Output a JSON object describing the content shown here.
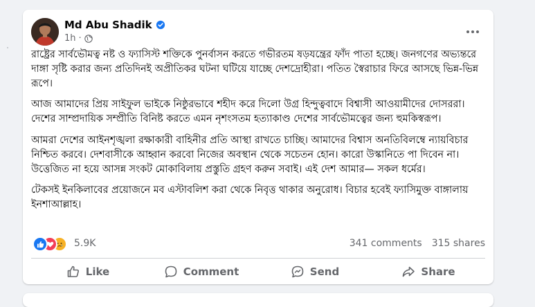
{
  "post": {
    "author": "Md Abu Shadik",
    "time": "1h",
    "dot": "·",
    "paragraphs": [
      "রাষ্ট্রের সার্বভৌমত্ব নষ্ট ও ফ্যাসিস্ট শক্তিকে পুনর্বাসন করতে গভীরতম ষড়যন্ত্রের ফাঁদ পাতা হচ্ছে। জনগণের অভ্যন্তরে দাঙ্গা সৃষ্টি করার জন্য প্রতিদিনই অপ্রীতিকর ঘটনা ঘটিয়ে যাচ্ছে দেশদ্রোহীরা। পতিত স্বৈরাচার ফিরে আসছে ভিন্ন-ভিন্ন রূপে।",
      "আজ আমাদের প্রিয় সাইফুল ভাইকে নিষ্ঠুরভাবে শহীদ করে দিলো উগ্র হিন্দুত্ববাদে বিশ্বাসী আওয়ামীদের দোসররা। দেশের সাম্প্রদায়িক সম্প্রীতি বিনিষ্ট করতে এমন নৃশংসতম হত্যাকাণ্ড দেশের সার্বভৌমত্বের জন্য হুমকিস্বরূপ।",
      "আমরা দেশের আইনশৃঙ্খলা রক্ষাকারী বাহিনীর প্রতি আস্থা রাখতে চাচ্ছি। আমাদের বিশ্বাস অনতিবিলম্বে ন্যায়বিচার নিশ্চিত করবে। দেশবাসীকে আহ্বান করবো নিজের অবস্থান থেকে সচেতন হোন। কারো উস্কানিতে পা দিবেন না। উত্তেজিত না হয়ে আসন্ন সংকট মোকাবিলায় প্রস্তুতি গ্রহণ করুন সবাই। এই দেশ আমার— সকল ধর্মের।",
      "টেকসই ইনকিলাবের প্রয়োজনে মব এস্টাবলিশ করা থেকে নিবৃত্ত থাকার অনুরোধ। বিচার হবেই ফ্যাসিমুক্ত বাঙ্গালায় ইনশাআল্লাহ।"
    ]
  },
  "stats": {
    "reactions": "5.9K",
    "comments": "341 comments",
    "shares": "315 shares"
  },
  "actions": {
    "like": "Like",
    "comment": "Comment",
    "send": "Send",
    "share": "Share"
  },
  "colors": {
    "accent": "#1877f2",
    "love": "#f33e58",
    "sad": "#f7b125",
    "secondary_text": "#65676b"
  },
  "icons": [
    "verified-badge-icon",
    "globe-icon",
    "more-options-icon",
    "like-reaction-icon",
    "love-reaction-icon",
    "sad-reaction-icon",
    "like-icon",
    "comment-icon",
    "send-icon",
    "share-icon"
  ]
}
